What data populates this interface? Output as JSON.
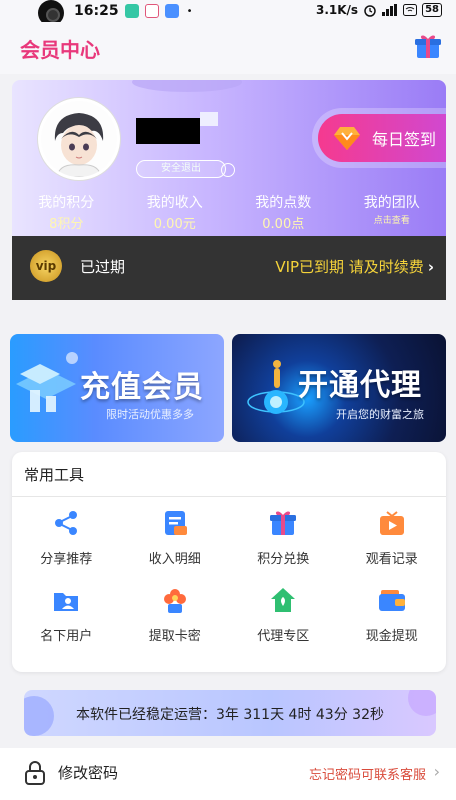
{
  "status_bar": {
    "time": "16:25",
    "dot": "•",
    "network_speed": "3.1K/s",
    "battery": "58"
  },
  "header": {
    "title": "会员中心"
  },
  "member_card": {
    "logout_label": "安全退出",
    "checkin_label": "每日签到",
    "stats": [
      {
        "label": "我的积分",
        "value": "8积分"
      },
      {
        "label": "我的收入",
        "value": "0.00元"
      },
      {
        "label": "我的点数",
        "value": "0.00点"
      },
      {
        "label": "我的团队",
        "value": "点击查看"
      }
    ],
    "vip_badge": "vip",
    "status": "已过期",
    "renew_text": "VIP已到期 请及时续费",
    "renew_arrow": "›"
  },
  "banners": {
    "recharge": {
      "title": "充值会员",
      "subtitle": "限时活动优惠多多"
    },
    "agent": {
      "title": "开通代理",
      "subtitle": "开启您的财富之旅"
    }
  },
  "tools": {
    "title": "常用工具",
    "items": [
      {
        "label": "分享推荐",
        "icon": "share-icon"
      },
      {
        "label": "收入明细",
        "icon": "income-detail-icon"
      },
      {
        "label": "积分兑换",
        "icon": "gift-icon"
      },
      {
        "label": "观看记录",
        "icon": "video-history-icon"
      },
      {
        "label": "名下用户",
        "icon": "users-folder-icon"
      },
      {
        "label": "提取卡密",
        "icon": "card-key-icon"
      },
      {
        "label": "代理专区",
        "icon": "agent-home-icon"
      },
      {
        "label": "现金提现",
        "icon": "wallet-icon"
      }
    ]
  },
  "uptime": {
    "text": "本软件已经稳定运营：3年 311天 4时 43分 32秒"
  },
  "password_row": {
    "label": "修改密码",
    "hint": "忘记密码可联系客服",
    "arrow": "›"
  },
  "colors": {
    "title": "#e8387b",
    "checkin": "#f53a8f",
    "renew": "#f5d33a",
    "hint": "#d94b3b"
  }
}
